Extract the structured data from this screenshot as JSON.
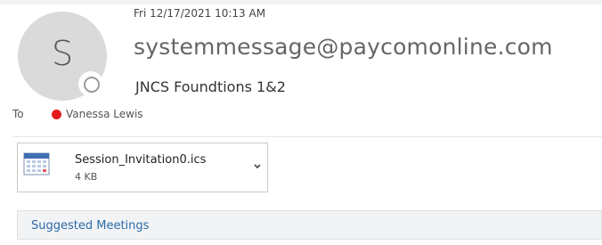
{
  "message": {
    "date": "Fri 12/17/2021 10:13 AM",
    "sender": "systemmessage@paycomonline.com",
    "subject": "JNCS Foundtions 1&2",
    "avatar_initial": "S",
    "to_label": "To",
    "recipient": {
      "name": "Vanessa Lewis",
      "presence_color": "#e31b1b"
    }
  },
  "attachment": {
    "name": "Session_Invitation0.ics",
    "size": "4 KB",
    "icon": "calendar-icon"
  },
  "suggested_meetings": {
    "label": "Suggested Meetings"
  },
  "colors": {
    "accent_link": "#2d6aa8",
    "avatar_bg": "#dadada",
    "presence_busy": "#e31b1b"
  }
}
